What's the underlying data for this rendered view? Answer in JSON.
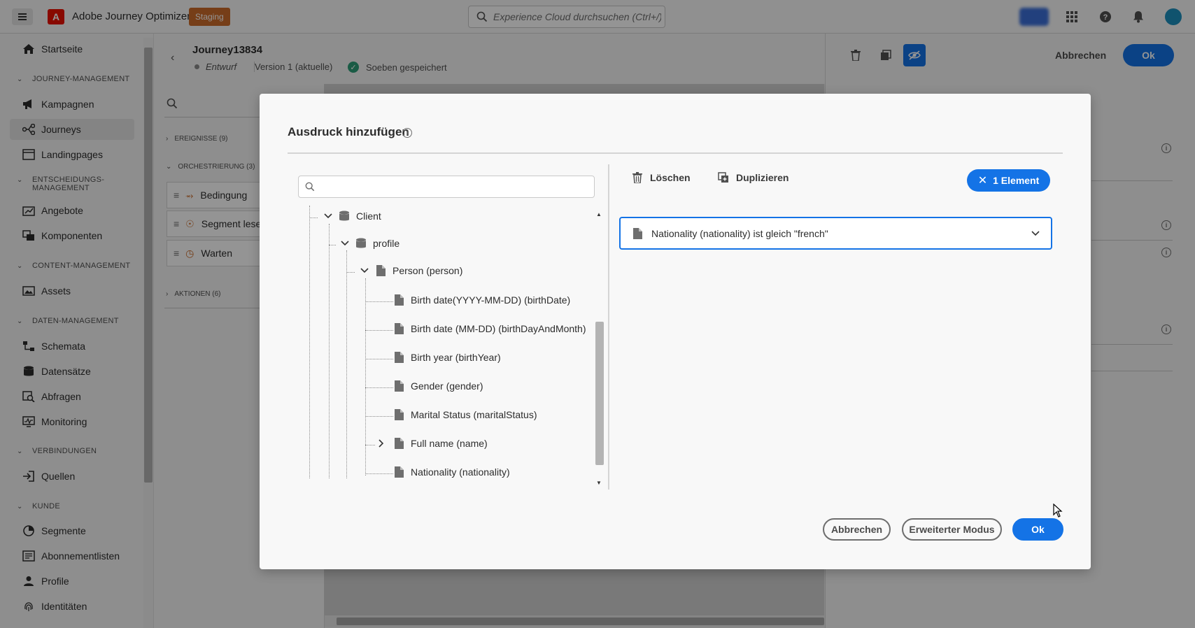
{
  "topbar": {
    "app_title": "Adobe Journey Optimizer",
    "logo_letter": "A",
    "env_badge": "Staging",
    "search_placeholder": "Experience Cloud durchsuchen (Ctrl+/)",
    "icons": [
      "menu-icon",
      "apps-grid-icon",
      "help-icon",
      "notifications-bell-icon",
      "avatar"
    ]
  },
  "sidebar": {
    "items_top": [
      {
        "label": "Startseite",
        "icon": "home-icon"
      }
    ],
    "sections": [
      {
        "title": "JOURNEY-MANAGEMENT",
        "items": [
          "Kampagnen",
          "Journeys",
          "Landingpages"
        ]
      },
      {
        "title_line1": "ENTSCHEIDUNGS-",
        "title_line2": "MANAGEMENT",
        "items": [
          "Angebote",
          "Komponenten"
        ]
      },
      {
        "title": "CONTENT-MANAGEMENT",
        "items": [
          "Assets"
        ]
      },
      {
        "title": "DATEN-MANAGEMENT",
        "items": [
          "Schemata",
          "Datensätze",
          "Abfragen",
          "Monitoring"
        ]
      },
      {
        "title": "VERBINDUNGEN",
        "items": [
          "Quellen"
        ]
      },
      {
        "title": "KUNDE",
        "items": [
          "Segmente",
          "Abonnementlisten",
          "Profile",
          "Identitäten"
        ]
      }
    ],
    "active_item": "Journeys"
  },
  "journey": {
    "name": "Journey13834",
    "status": "Entwurf",
    "version": "Version 1 (aktuelle)",
    "saved": "Soeben gespeichert",
    "palette_sections": [
      "EREIGNISSE (9)",
      "ORCHESTRIERUNG (3)",
      "AKTIONEN (6)"
    ],
    "palette_items": [
      "Bedingung",
      "Segment lese",
      "Warten"
    ]
  },
  "right_panel": {
    "cancel_label": "Abbrechen",
    "ok_label": "Ok"
  },
  "modal": {
    "title": "Ausdruck hinzufügen",
    "search_placeholder": "",
    "tree": {
      "client": "Client",
      "profile": "profile",
      "person": "Person (person)",
      "fields": [
        "Birth date(YYYY-MM-DD) (birthDate)",
        "Birth date (MM-DD) (birthDayAndMonth)",
        "Birth year (birthYear)",
        "Gender (gender)",
        "Marital Status (maritalStatus)",
        "Full name (name)",
        "Nationality (nationality)"
      ]
    },
    "delete_label": "Löschen",
    "duplicate_label": "Duplizieren",
    "selection_label": "1 Element",
    "condition_text": "Nationality (nationality) ist gleich \"french\"",
    "cancel_label": "Abbrechen",
    "advanced_label": "Erweiterter Modus",
    "ok_label": "Ok"
  },
  "colors": {
    "accent": "#1473e6",
    "staging": "#cb6c2a",
    "adobe_red": "#eb1000"
  }
}
